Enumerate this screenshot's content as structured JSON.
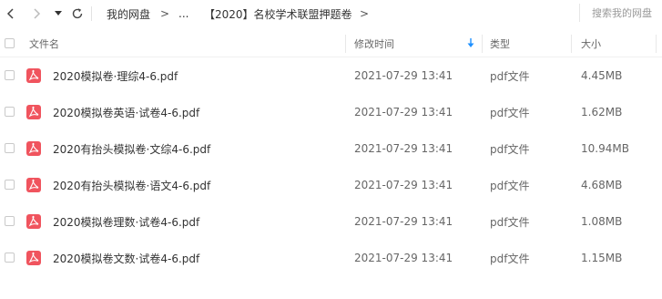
{
  "toolbar": {
    "back_icon": "chevron-left-icon",
    "forward_icon": "chevron-right-icon",
    "dropdown_icon": "caret-down-icon",
    "refresh_icon": "refresh-icon",
    "breadcrumb": {
      "root": "我的网盘",
      "sep1": ">",
      "ellipsis": "...",
      "current": "【2020】名校学术联盟押题卷",
      "sep2": ">"
    },
    "search_placeholder": "搜索我的网盘"
  },
  "header": {
    "name": "文件名",
    "modified": "修改时间",
    "type": "类型",
    "size": "大小",
    "sort_icon": "arrow-down-icon"
  },
  "colors": {
    "accent": "#1e90ff",
    "pdf": "#f0545e"
  },
  "files": [
    {
      "name": "2020模拟卷·理综4-6.pdf",
      "modified": "2021-07-29 13:41",
      "type": "pdf文件",
      "size": "4.45MB",
      "icon": "pdf-icon"
    },
    {
      "name": "2020模拟卷英语·试卷4-6.pdf",
      "modified": "2021-07-29 13:41",
      "type": "pdf文件",
      "size": "1.62MB",
      "icon": "pdf-icon"
    },
    {
      "name": "2020有抬头模拟卷·文综4-6.pdf",
      "modified": "2021-07-29 13:41",
      "type": "pdf文件",
      "size": "10.94MB",
      "icon": "pdf-icon"
    },
    {
      "name": "2020有抬头模拟卷·语文4-6.pdf",
      "modified": "2021-07-29 13:41",
      "type": "pdf文件",
      "size": "4.68MB",
      "icon": "pdf-icon"
    },
    {
      "name": "2020模拟卷理数·试卷4-6.pdf",
      "modified": "2021-07-29 13:41",
      "type": "pdf文件",
      "size": "1.08MB",
      "icon": "pdf-icon"
    },
    {
      "name": "2020模拟卷文数·试卷4-6.pdf",
      "modified": "2021-07-29 13:41",
      "type": "pdf文件",
      "size": "1.15MB",
      "icon": "pdf-icon"
    }
  ]
}
